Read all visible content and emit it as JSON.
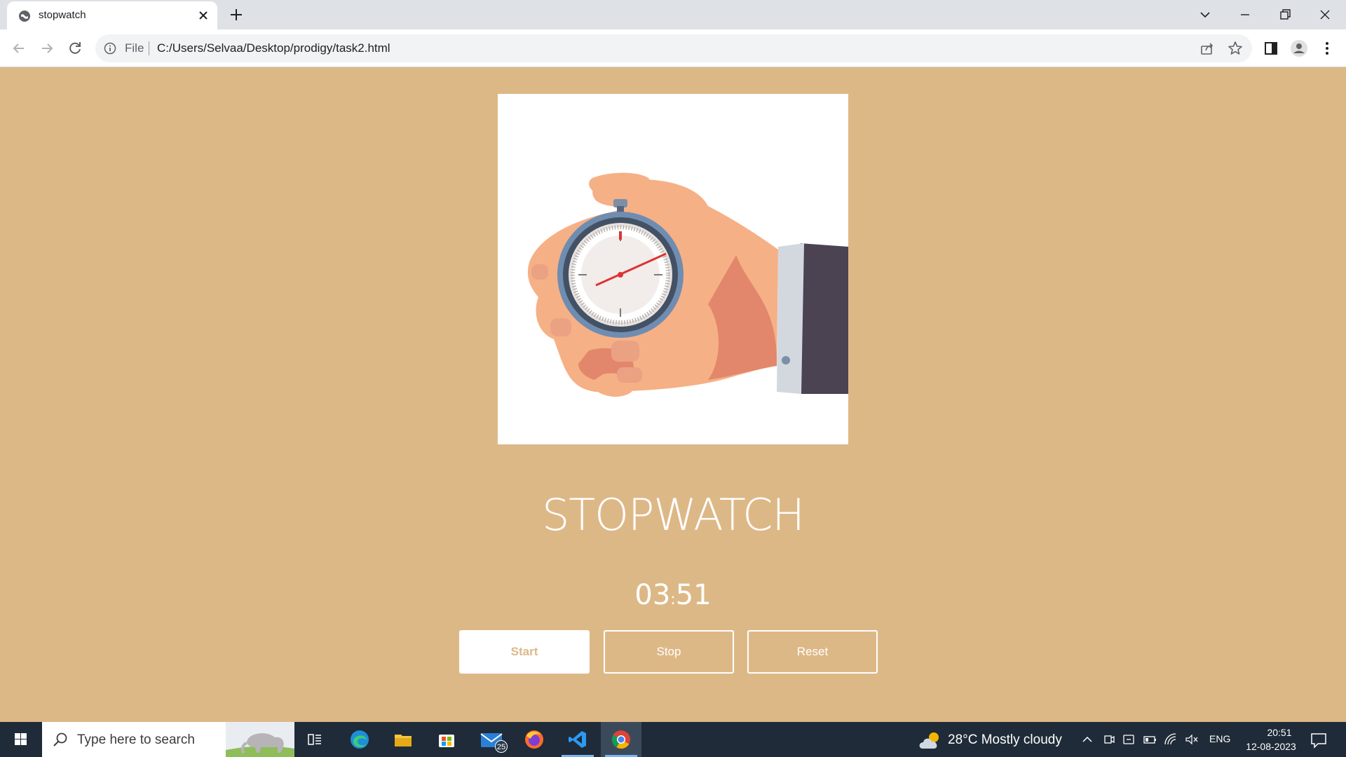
{
  "browser": {
    "tab": {
      "title": "stopwatch"
    },
    "address": {
      "scheme_label": "File",
      "url": "C:/Users/Selvaa/Desktop/prodigy/task2.html"
    },
    "icons": [
      "chrome-favicon",
      "close-icon",
      "plus-icon",
      "chevron-down-icon",
      "minimize-icon",
      "restore-icon",
      "back-icon",
      "forward-icon",
      "reload-icon",
      "info-icon",
      "share-icon",
      "star-icon",
      "side-panel-icon",
      "profile-icon",
      "more-icon"
    ]
  },
  "page": {
    "title": "STOPWATCH",
    "time": {
      "minutes": "03",
      "separator": ":",
      "seconds": "51"
    },
    "buttons": {
      "start": "Start",
      "stop": "Stop",
      "reset": "Reset"
    },
    "colors": {
      "background": "#ddb887",
      "text": "#ffffff"
    }
  },
  "taskbar": {
    "search_placeholder": "Type here to search",
    "mail_badge": "25",
    "weather": "28°C  Mostly cloudy",
    "language": "ENG",
    "time": "20:51",
    "date": "12-08-2023",
    "apps": [
      "task-view",
      "edge",
      "file-explorer",
      "microsoft-store",
      "mail",
      "firefox",
      "vscode",
      "chrome"
    ]
  }
}
